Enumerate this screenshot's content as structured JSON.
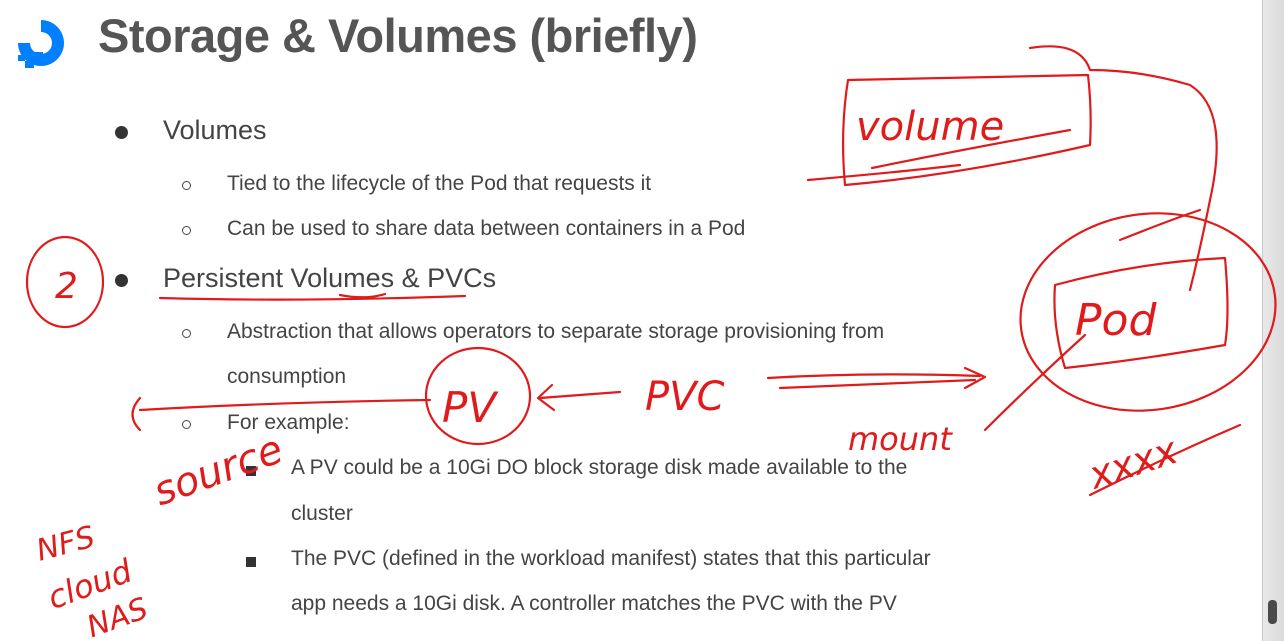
{
  "slide": {
    "title": "Storage & Volumes (briefly)",
    "logo_icon": "digitalocean-logo-icon",
    "items": [
      {
        "label": "Volumes",
        "sub": [
          "Tied to the lifecycle of the Pod that requests it",
          "Can be used to share data between containers in a Pod"
        ]
      },
      {
        "label": "Persistent Volumes & PVCs",
        "sub": [
          "Abstraction that allows operators to separate storage provisioning from",
          "consumption",
          "For example:"
        ],
        "subsub": [
          "A PV could be a 10Gi DO block storage disk made available to the",
          "cluster",
          "The PVC (defined in the workload manifest) states that this particular",
          "app needs a 10Gi disk. A controller matches the PVC with the PV"
        ]
      }
    ]
  },
  "annotations": {
    "color": "#e01b1b",
    "volume": "volume",
    "pod": "Pod",
    "number": "2",
    "pv": "PV",
    "pvc": "PVC",
    "mount": "mount",
    "source": "source",
    "nfs": "NFS",
    "cloud": "cloud",
    "nas": "NAS",
    "xxxx": "xxxx"
  },
  "colors": {
    "logo_blue": "#0080ff",
    "title": "#555555",
    "ink": "#e01b1b"
  }
}
